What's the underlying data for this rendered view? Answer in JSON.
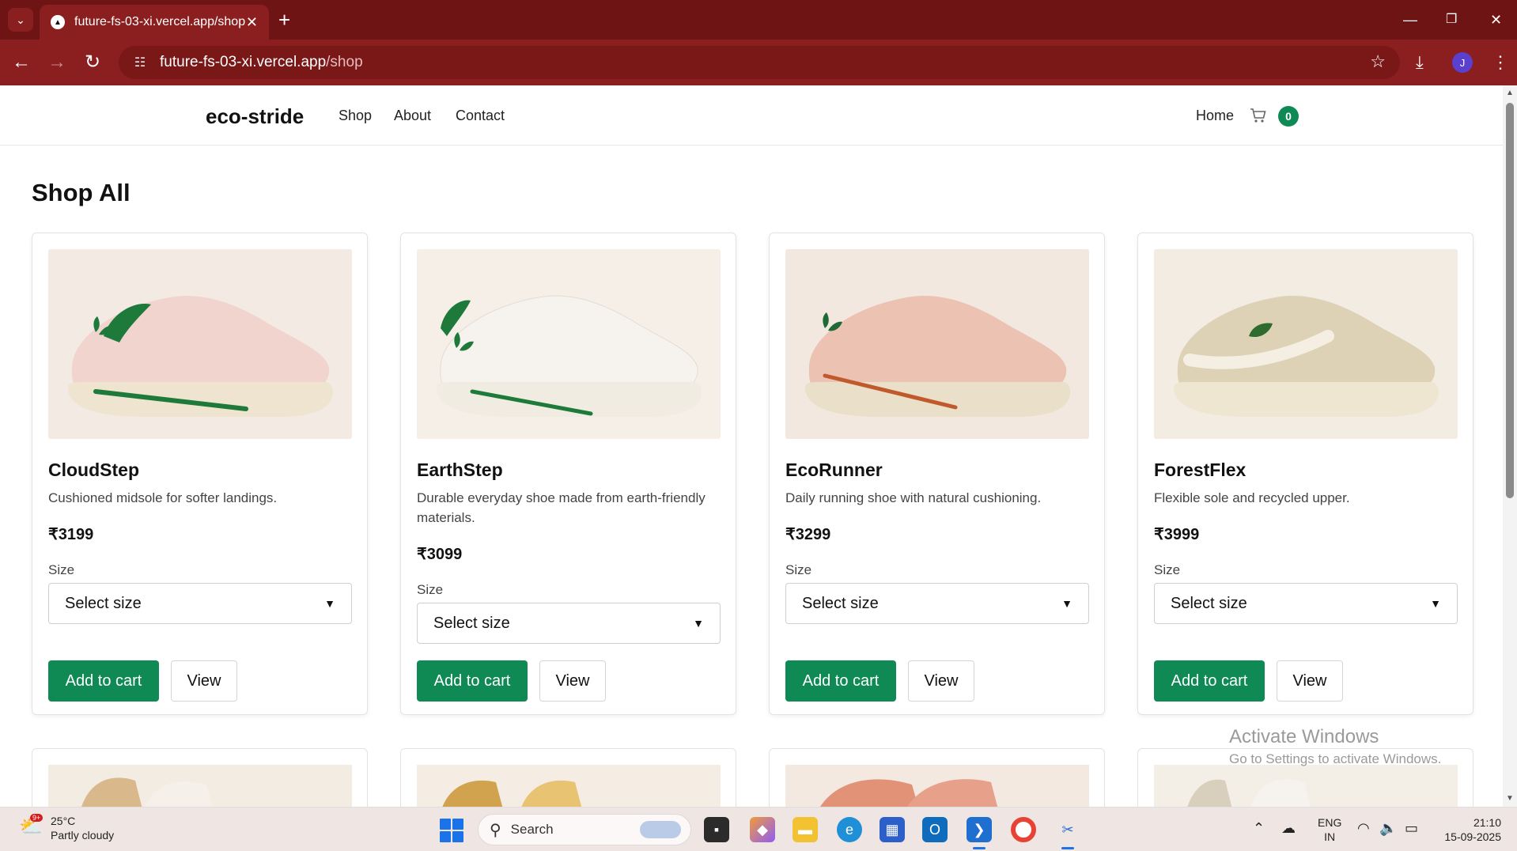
{
  "browser": {
    "tab_title": "future-fs-03-xi.vercel.app/shop",
    "url_host": "future-fs-03-xi.vercel.app",
    "url_path": "/shop",
    "avatar_letter": "J",
    "theme_color": "#8b1e1e"
  },
  "site": {
    "brand": "eco-stride",
    "nav": [
      "Shop",
      "About",
      "Contact"
    ],
    "home_link": "Home",
    "cart_count": "0",
    "accent_color": "#0f8a55"
  },
  "page": {
    "title": "Shop All"
  },
  "products": [
    {
      "name": "CloudStep",
      "description": "Cushioned midsole for softer landings.",
      "price": "₹3199",
      "size_label": "Size",
      "size_select": "Select size",
      "add_label": "Add to cart",
      "view_label": "View",
      "shoe_color": "#f1d4ce",
      "stripe_color": "#1e7a3a"
    },
    {
      "name": "EarthStep",
      "description": "Durable everyday shoe made from earth-friendly materials.",
      "price": "₹3099",
      "size_label": "Size",
      "size_select": "Select size",
      "add_label": "Add to cart",
      "view_label": "View",
      "shoe_color": "#f6f3ee",
      "stripe_color": "#1e7a3a"
    },
    {
      "name": "EcoRunner",
      "description": "Daily running shoe with natural cushioning.",
      "price": "₹3299",
      "size_label": "Size",
      "size_select": "Select size",
      "add_label": "Add to cart",
      "view_label": "View",
      "shoe_color": "#ecc2b2",
      "stripe_color": "#c05a2c"
    },
    {
      "name": "ForestFlex",
      "description": "Flexible sole and recycled upper.",
      "price": "₹3999",
      "size_label": "Size",
      "size_select": "Select size",
      "add_label": "Add to cart",
      "view_label": "View",
      "shoe_color": "#ddd2b6",
      "stripe_color": "#f4efe2"
    }
  ],
  "watermark": {
    "line1": "Activate Windows",
    "line2": "Go to Settings to activate Windows."
  },
  "taskbar": {
    "temperature": "25°C",
    "weather": "Partly cloudy",
    "weather_badge": "9+",
    "search_placeholder": "Search",
    "lang_top": "ENG",
    "lang_bottom": "IN",
    "time": "21:10",
    "date": "15-09-2025"
  }
}
